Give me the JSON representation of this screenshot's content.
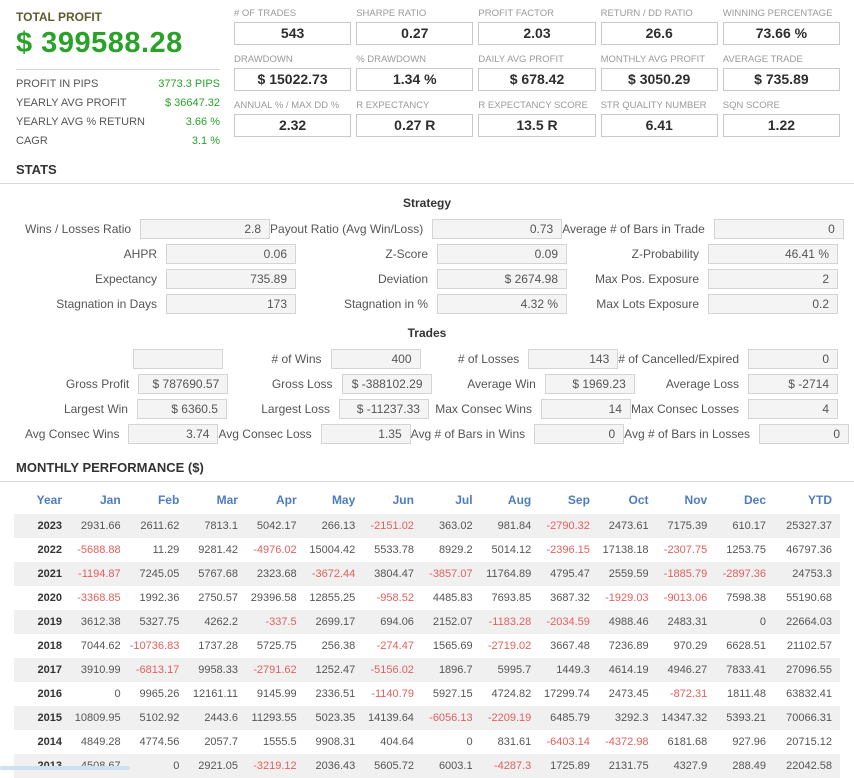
{
  "colors": {
    "profit_green": "#28a228",
    "negative_red": "#e2605e",
    "header_blue": "#4d7cc1",
    "label_olive": "#5c5c2e"
  },
  "summary": {
    "title": "TOTAL PROFIT",
    "total": "$ 399588.28",
    "rows": [
      {
        "label": "PROFIT IN PIPS",
        "value": "3773.3 PIPS"
      },
      {
        "label": "YEARLY AVG PROFIT",
        "value": "$ 36647.32"
      },
      {
        "label": "YEARLY AVG % RETURN",
        "value": "3.66 %"
      },
      {
        "label": "CAGR",
        "value": "3.1 %"
      }
    ]
  },
  "metrics": [
    {
      "label": "# OF TRADES",
      "value": "543"
    },
    {
      "label": "SHARPE RATIO",
      "value": "0.27"
    },
    {
      "label": "PROFIT FACTOR",
      "value": "2.03"
    },
    {
      "label": "RETURN / DD RATIO",
      "value": "26.6"
    },
    {
      "label": "WINNING PERCENTAGE",
      "value": "73.66 %"
    },
    {
      "label": "DRAWDOWN",
      "value": "$ 15022.73"
    },
    {
      "label": "% DRAWDOWN",
      "value": "1.34 %"
    },
    {
      "label": "DAILY AVG PROFIT",
      "value": "$ 678.42"
    },
    {
      "label": "MONTHLY AVG PROFIT",
      "value": "$ 3050.29"
    },
    {
      "label": "AVERAGE TRADE",
      "value": "$ 735.89"
    },
    {
      "label": "ANNUAL % / MAX DD %",
      "value": "2.32"
    },
    {
      "label": "R EXPECTANCY",
      "value": "0.27 R"
    },
    {
      "label": "R EXPECTANCY SCORE",
      "value": "13.5 R"
    },
    {
      "label": "STR QUALITY NUMBER",
      "value": "6.41"
    },
    {
      "label": "SQN SCORE",
      "value": "1.22"
    }
  ],
  "stats": {
    "title": "STATS",
    "strategy": {
      "title": "Strategy",
      "rows": [
        [
          {
            "label": "Wins / Losses Ratio",
            "value": "2.8"
          },
          {
            "label": "Payout Ratio (Avg Win/Loss)",
            "value": "0.73"
          },
          {
            "label": "Average # of Bars in Trade",
            "value": "0"
          }
        ],
        [
          {
            "label": "AHPR",
            "value": "0.06"
          },
          {
            "label": "Z-Score",
            "value": "0.09"
          },
          {
            "label": "Z-Probability",
            "value": "46.41 %"
          }
        ],
        [
          {
            "label": "Expectancy",
            "value": "735.89"
          },
          {
            "label": "Deviation",
            "value": "$ 2674.98"
          },
          {
            "label": "Max Pos. Exposure",
            "value": "2"
          }
        ],
        [
          {
            "label": "Stagnation in Days",
            "value": "173"
          },
          {
            "label": "Stagnation in %",
            "value": "4.32 %"
          },
          {
            "label": "Max Lots Exposure",
            "value": "0.2"
          }
        ]
      ]
    },
    "trades": {
      "title": "Trades",
      "rows": [
        [
          {
            "label": "",
            "value": ""
          },
          {
            "label": "# of Wins",
            "value": "400"
          },
          {
            "label": "# of Losses",
            "value": "143"
          },
          {
            "label": "# of Cancelled/Expired",
            "value": "0"
          }
        ],
        [
          {
            "label": "Gross Profit",
            "value": "$ 787690.57"
          },
          {
            "label": "Gross Loss",
            "value": "$ -388102.29"
          },
          {
            "label": "Average Win",
            "value": "$ 1969.23"
          },
          {
            "label": "Average Loss",
            "value": "$ -2714"
          }
        ],
        [
          {
            "label": "Largest Win",
            "value": "$ 6360.5"
          },
          {
            "label": "Largest Loss",
            "value": "$ -11237.33"
          },
          {
            "label": "Max Consec Wins",
            "value": "14"
          },
          {
            "label": "Max Consec Losses",
            "value": "4"
          }
        ],
        [
          {
            "label": "Avg Consec Wins",
            "value": "3.74"
          },
          {
            "label": "Avg Consec Loss",
            "value": "1.35"
          },
          {
            "label": "Avg # of Bars in Wins",
            "value": "0"
          },
          {
            "label": "Avg # of Bars in Losses",
            "value": "0"
          }
        ]
      ]
    }
  },
  "monthly": {
    "title": "MONTHLY PERFORMANCE ($)",
    "columns": [
      "Year",
      "Jan",
      "Feb",
      "Mar",
      "Apr",
      "May",
      "Jun",
      "Jul",
      "Aug",
      "Sep",
      "Oct",
      "Nov",
      "Dec",
      "YTD"
    ],
    "rows": [
      {
        "year": "2023",
        "values": [
          "2931.66",
          "2611.62",
          "7813.1",
          "5042.17",
          "266.13",
          "-2151.02",
          "363.02",
          "981.84",
          "-2790.32",
          "2473.61",
          "7175.39",
          "610.17",
          "25327.37"
        ]
      },
      {
        "year": "2022",
        "values": [
          "-5688.88",
          "11.29",
          "9281.42",
          "-4976.02",
          "15004.42",
          "5533.78",
          "8929.2",
          "5014.12",
          "-2396.15",
          "17138.18",
          "-2307.75",
          "1253.75",
          "46797.36"
        ]
      },
      {
        "year": "2021",
        "values": [
          "-1194.87",
          "7245.05",
          "5767.68",
          "2323.68",
          "-3672.44",
          "3804.47",
          "-3857.07",
          "11764.89",
          "4795.47",
          "2559.59",
          "-1885.79",
          "-2897.36",
          "24753.3"
        ]
      },
      {
        "year": "2020",
        "values": [
          "-3368.85",
          "1992.36",
          "2750.57",
          "29396.58",
          "12855.25",
          "-958.52",
          "4485.83",
          "7693.85",
          "3687.32",
          "-1929.03",
          "-9013.06",
          "7598.38",
          "55190.68"
        ]
      },
      {
        "year": "2019",
        "values": [
          "3612.38",
          "5327.75",
          "4262.2",
          "-337.5",
          "2699.17",
          "694.06",
          "2152.07",
          "-1183.28",
          "-2034.59",
          "4988.46",
          "2483.31",
          "0",
          "22664.03"
        ]
      },
      {
        "year": "2018",
        "values": [
          "7044.62",
          "-10736.83",
          "1737.28",
          "5725.75",
          "256.38",
          "-274.47",
          "1565.69",
          "-2719.02",
          "3667.48",
          "7236.89",
          "970.29",
          "6628.51",
          "21102.57"
        ]
      },
      {
        "year": "2017",
        "values": [
          "3910.99",
          "-6813.17",
          "9958.33",
          "-2791.62",
          "1252.47",
          "-5156.02",
          "1896.7",
          "5995.7",
          "1449.3",
          "4614.19",
          "4946.27",
          "7833.41",
          "27096.55"
        ]
      },
      {
        "year": "2016",
        "values": [
          "0",
          "9965.26",
          "12161.11",
          "9145.99",
          "2336.51",
          "-1140.79",
          "5927.15",
          "4724.82",
          "17299.74",
          "2473.45",
          "-872.31",
          "1811.48",
          "63832.41"
        ]
      },
      {
        "year": "2015",
        "values": [
          "10809.95",
          "5102.92",
          "2443.6",
          "11293.55",
          "5023.35",
          "14139.64",
          "-6056.13",
          "-2209.19",
          "6485.79",
          "3292.3",
          "14347.32",
          "5393.21",
          "70066.31"
        ]
      },
      {
        "year": "2014",
        "values": [
          "4849.28",
          "4774.56",
          "2057.7",
          "1555.5",
          "9908.31",
          "404.64",
          "0",
          "831.61",
          "-6403.14",
          "-4372.98",
          "6181.68",
          "927.96",
          "20715.12"
        ]
      },
      {
        "year": "2013",
        "values": [
          "4508.67",
          "0",
          "2921.05",
          "-3219.12",
          "2036.43",
          "5605.72",
          "6003.1",
          "-4287.3",
          "1725.89",
          "2131.75",
          "4327.9",
          "288.49",
          "22042.58"
        ]
      }
    ]
  }
}
